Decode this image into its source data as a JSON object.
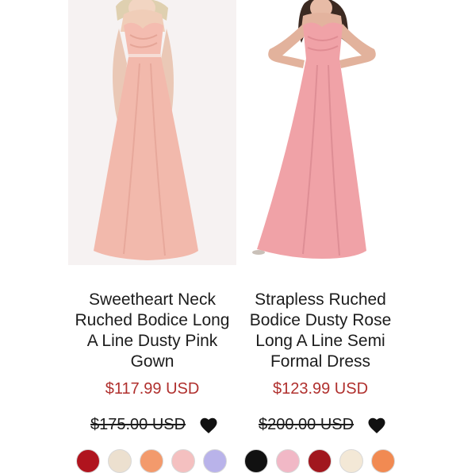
{
  "products": [
    {
      "title_lines": [
        "Sweetheart Neck",
        "Ruched Bodice Long",
        "A Line Dusty Pink",
        "Gown"
      ],
      "price": "$117.99 USD",
      "original_price": "$175.00 USD",
      "favorite_icon": "heart-icon",
      "swatches": [
        "#b0141e",
        "#ece0cf",
        "#f39a6c",
        "#f4c0c0",
        "#b9b3ea"
      ]
    },
    {
      "title_lines": [
        "Strapless Ruched",
        "Bodice Dusty Rose",
        "Long A Line Semi",
        "Formal Dress"
      ],
      "price": "$123.99 USD",
      "original_price": "$200.00 USD",
      "favorite_icon": "heart-icon",
      "swatches": [
        "#111111",
        "#f1b8c6",
        "#a1171e",
        "#f3e8d6",
        "#f18a52"
      ]
    }
  ],
  "colors": {
    "price": "#b0302e",
    "text": "#1c1c1c",
    "dress_left": "#f2b9ac",
    "dress_right": "#f0a2a7"
  }
}
